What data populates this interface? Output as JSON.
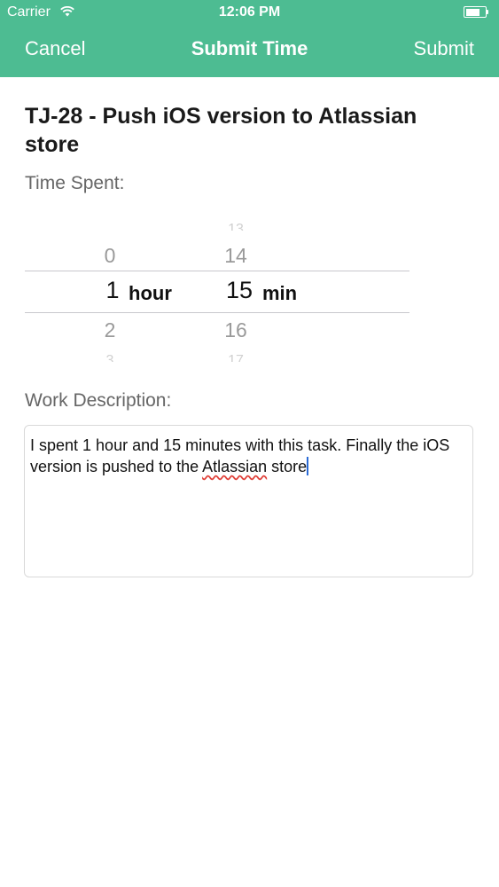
{
  "status_bar": {
    "carrier": "Carrier",
    "time": "12:06 PM"
  },
  "nav": {
    "cancel_label": "Cancel",
    "title": "Submit Time",
    "submit_label": "Submit"
  },
  "task": {
    "title": "TJ-28 - Push iOS version to Atlassian store"
  },
  "time_spent": {
    "label": "Time Spent:",
    "hours": {
      "values_above": [
        "0"
      ],
      "selected": "1",
      "unit": "hour",
      "values_below": [
        "2",
        "3"
      ]
    },
    "minutes": {
      "values_above": [
        "13",
        "14"
      ],
      "selected": "15",
      "unit": "min",
      "values_below": [
        "16",
        "17"
      ]
    }
  },
  "work_description": {
    "label": "Work Description:",
    "text_before": "I spent 1 hour and 15 minutes with this task. Finally the iOS version is pushed to the ",
    "text_misspelled": "Atlassian",
    "text_after": " store"
  },
  "colors": {
    "header": "#4dbc92",
    "caret": "#2b6bd6",
    "spellcheck": "#e0413a"
  }
}
